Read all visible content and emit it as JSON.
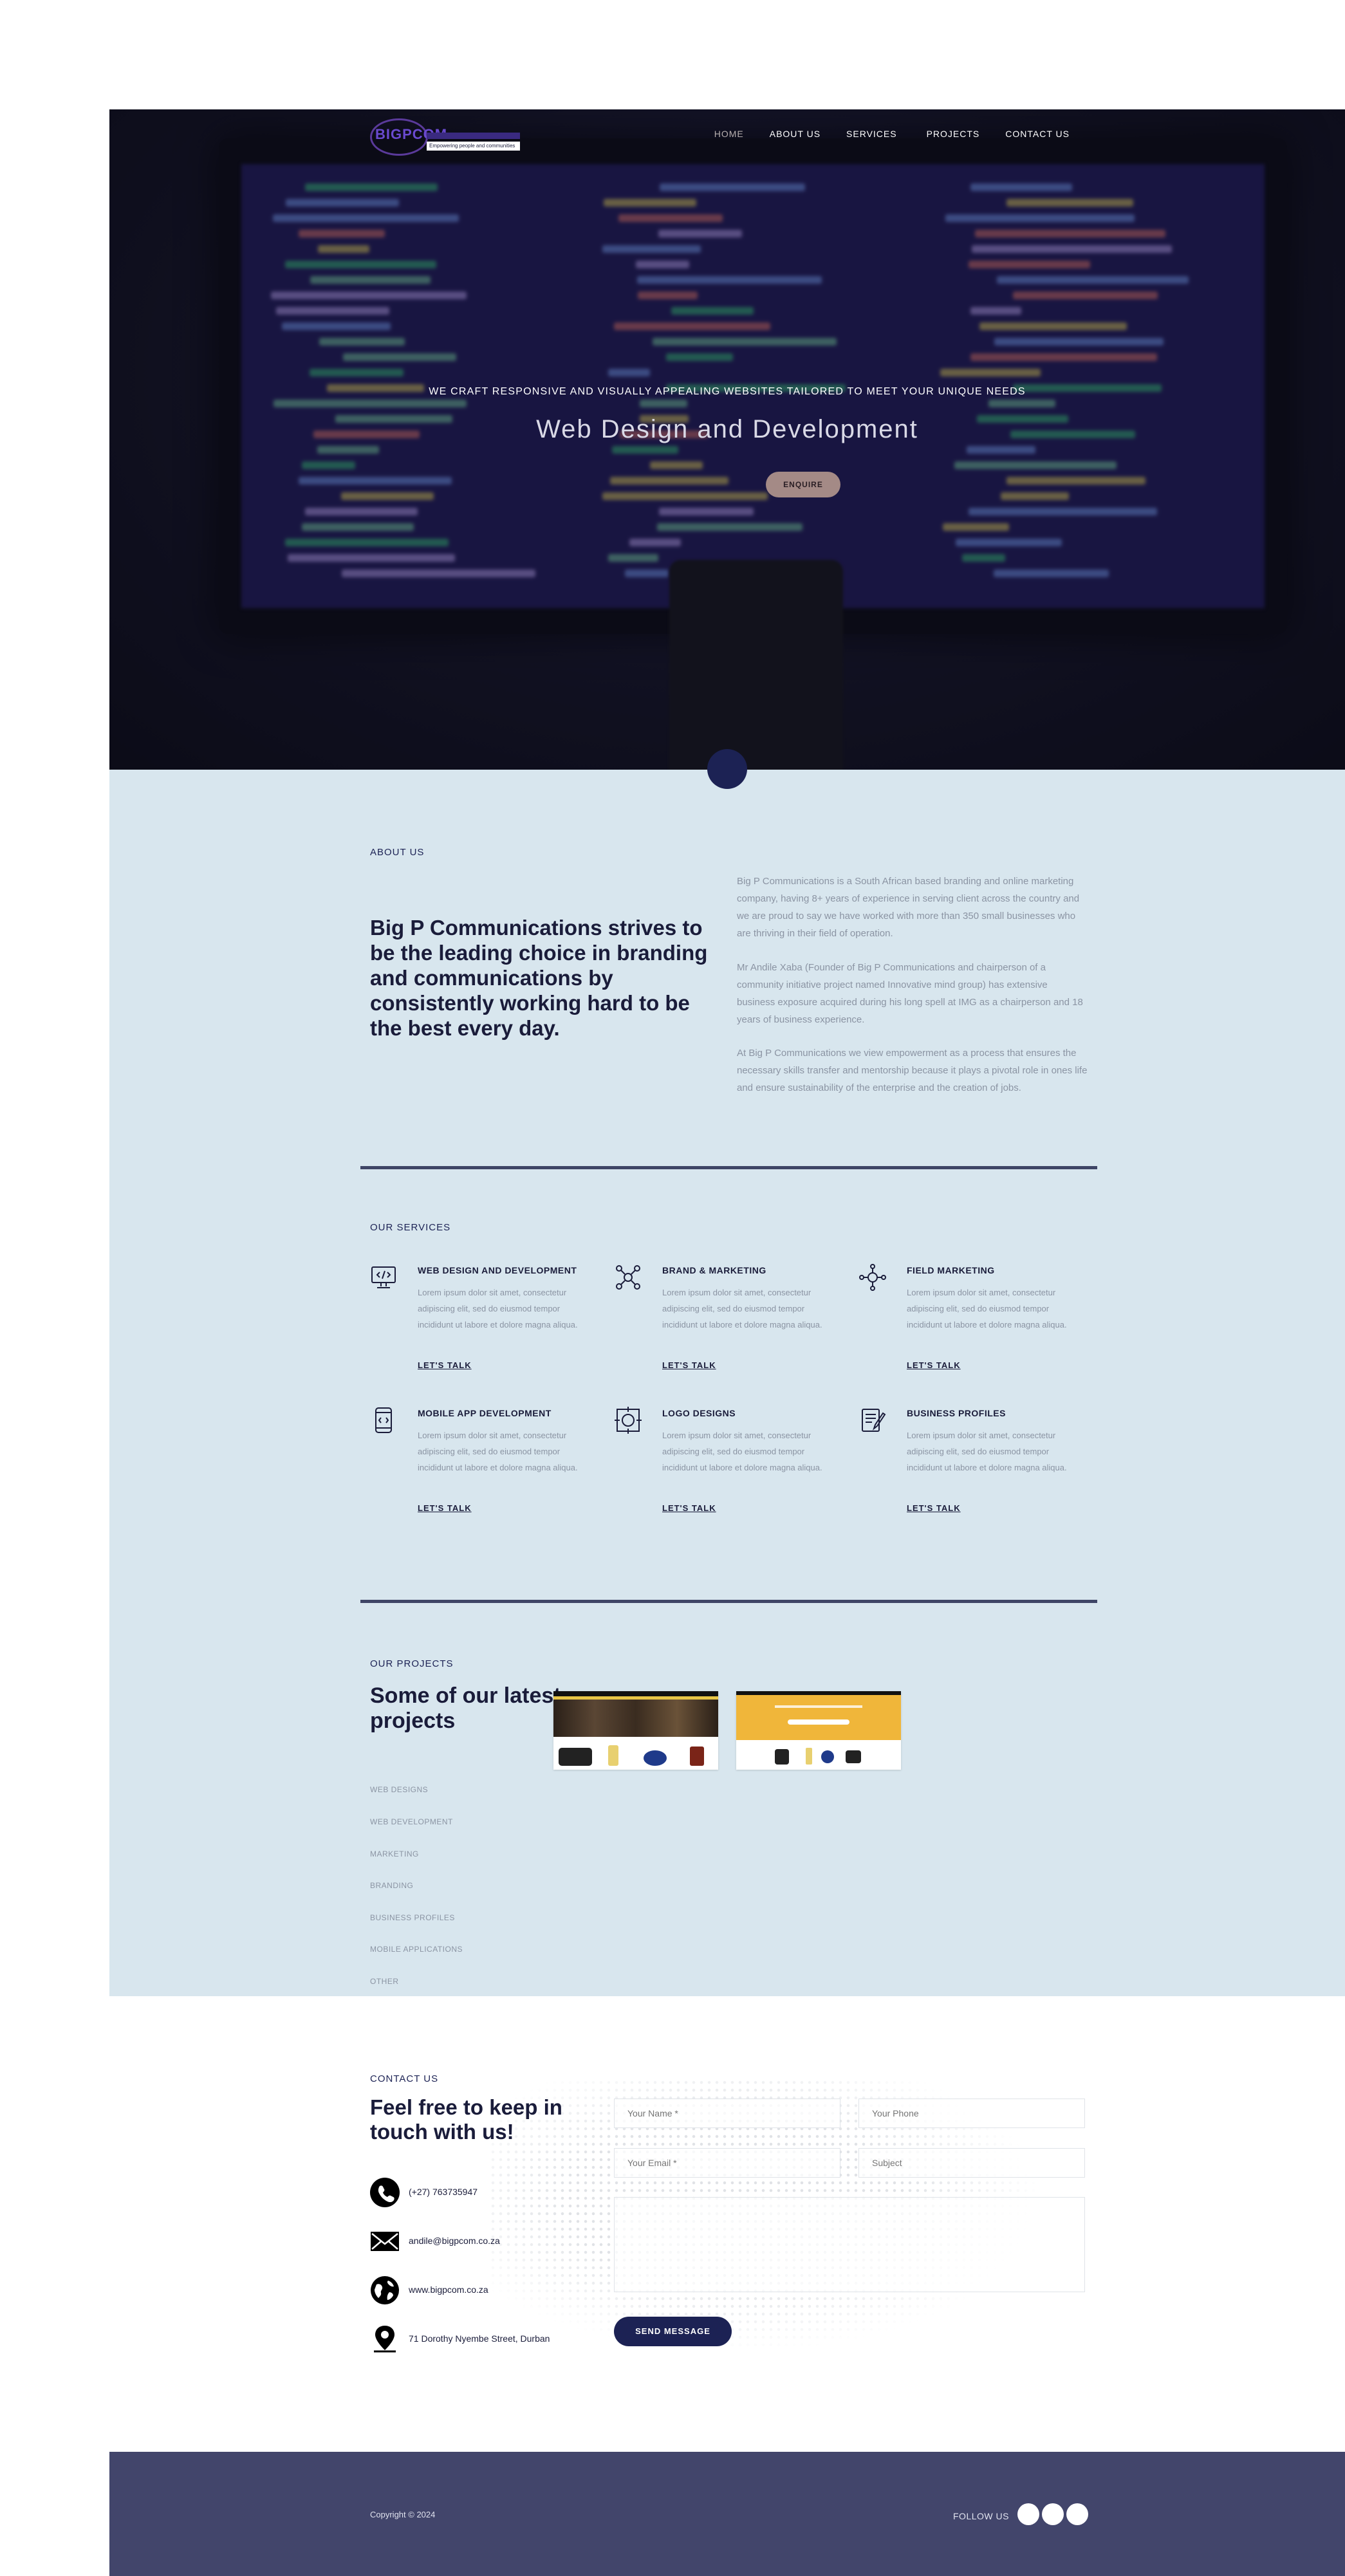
{
  "nav": {
    "logo_text": "BIGPCOM",
    "logo_tagline": "Empowering people and communities",
    "items": [
      {
        "label": "HOME",
        "active": true
      },
      {
        "label": "ABOUT US",
        "active": false
      },
      {
        "label": "SERVICES",
        "active": false
      },
      {
        "label": "PROJECTS",
        "active": false
      },
      {
        "label": "CONTACT US",
        "active": false
      }
    ]
  },
  "hero": {
    "kicker": "WE CRAFT RESPONSIVE AND VISUALLY APPEALING WEBSITES TAILORED TO MEET YOUR UNIQUE NEEDS",
    "title": "Web Design and Development",
    "button": "ENQUIRE"
  },
  "about": {
    "label": "ABOUT US",
    "heading": "Big P Communications strives to be the leading choice in branding and communications by consistently working hard to be the best every day.",
    "paragraphs": [
      "Big P Communications is a South African based branding and online marketing company, having 8+ years of experience in serving client across the country and we are proud to say we have worked with more than 350 small businesses who are thriving in their field of operation.",
      "Mr Andile Xaba (Founder of Big P Communications and chairperson of a community initiative project named Innovative mind group) has extensive business exposure acquired during his long spell at IMG as a chairperson and 18 years of business experience.",
      "At Big P Communications we view empowerment as a process that ensures the necessary skills transfer and mentorship because it plays a pivotal role in ones life and ensure sustainability of the enterprise and the creation of jobs."
    ]
  },
  "services": {
    "label": "OUR SERVICES",
    "items": [
      {
        "title": "WEB DESIGN AND DEVELOPMENT",
        "icon": "monitor-code-icon",
        "desc": "Lorem ipsum dolor sit amet, consectetur adipiscing elit, sed do eiusmod tempor incididunt ut labore et dolore magna aliqua.",
        "link": "LET'S TALK"
      },
      {
        "title": "BRAND & MARKETING",
        "icon": "network-gear-icon",
        "desc": "Lorem ipsum dolor sit amet, consectetur adipiscing elit, sed do eiusmod tempor incididunt ut labore et dolore magna aliqua.",
        "link": "LET'S TALK"
      },
      {
        "title": "FIELD MARKETING",
        "icon": "hub-people-icon",
        "desc": "Lorem ipsum dolor sit amet, consectetur adipiscing elit, sed do eiusmod tempor incididunt ut labore et dolore magna aliqua.",
        "link": "LET'S TALK"
      },
      {
        "title": "MOBILE APP DEVELOPMENT",
        "icon": "phone-code-icon",
        "desc": "Lorem ipsum dolor sit amet, consectetur adipiscing elit, sed do eiusmod tempor incididunt ut labore et dolore magna aliqua.",
        "link": "LET'S TALK"
      },
      {
        "title": "LOGO DESIGNS",
        "icon": "logo-design-icon",
        "desc": "Lorem ipsum dolor sit amet, consectetur adipiscing elit, sed do eiusmod tempor incididunt ut labore et dolore magna aliqua.",
        "link": "LET'S TALK"
      },
      {
        "title": "BUSINESS PROFILES",
        "icon": "document-pen-icon",
        "desc": "Lorem ipsum dolor sit amet, consectetur adipiscing elit, sed do eiusmod tempor incididunt ut labore et dolore magna aliqua.",
        "link": "LET'S TALK"
      }
    ]
  },
  "projects": {
    "label": "OUR PROJECTS",
    "heading": "Some of our latest projects",
    "filters": [
      "WEB DESIGNS",
      "WEB DEVELOPMENT",
      "MARKETING",
      "BRANDING",
      "BUSINESS PROFILES",
      "MOBILE APPLICATIONS",
      "OTHER"
    ]
  },
  "contact": {
    "label": "CONTACT US",
    "heading": "Feel free to keep in touch with us!",
    "phone": "(+27) 763735947",
    "email": "andile@bigpcom.co.za",
    "website": "www.bigpcom.co.za",
    "address": "71 Dorothy Nyembe Street, Durban",
    "form": {
      "name_placeholder": "Your Name *",
      "phone_placeholder": "Your Phone",
      "email_placeholder": "Your Email *",
      "subject_placeholder": "Subject",
      "button": "SEND MESSAGE"
    }
  },
  "footer": {
    "copyright": "Copyright © 2024",
    "follow": "FOLLOW US"
  },
  "colors": {
    "navy": "#1c2254",
    "light_bg": "#d8e6ee",
    "footer_bg": "#42456b",
    "enquire_bg": "#a48a86",
    "muted_text": "#8b94a3"
  }
}
